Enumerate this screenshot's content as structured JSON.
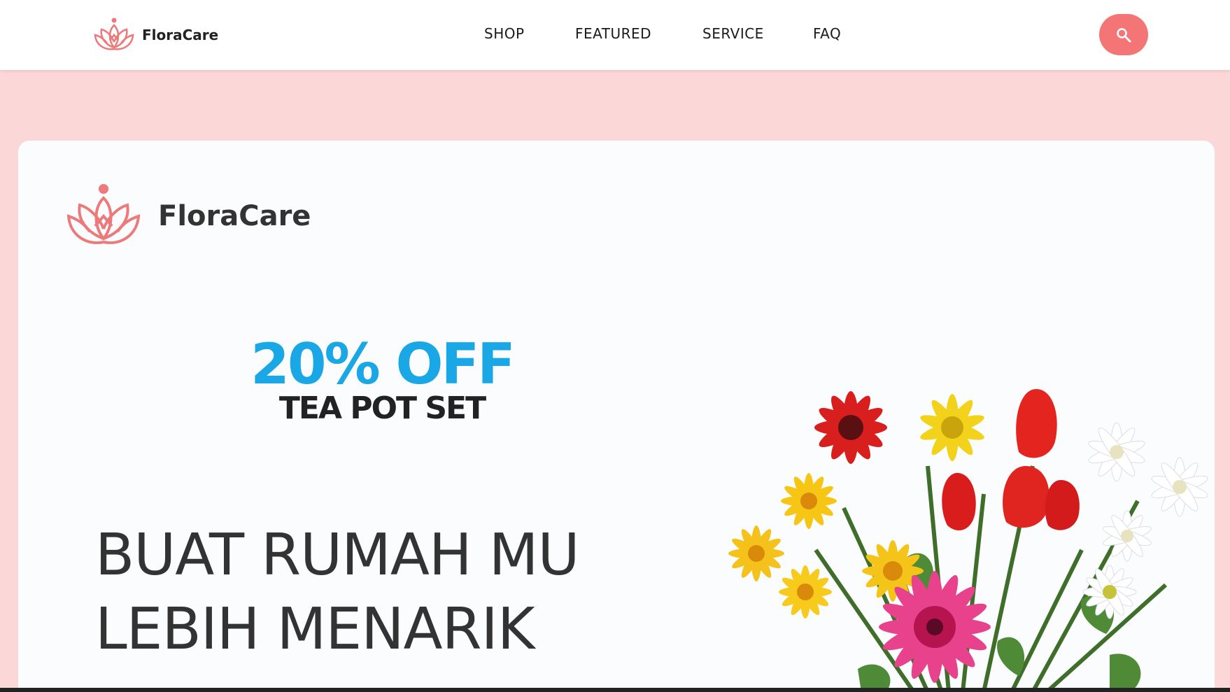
{
  "header": {
    "brand": "FloraCare",
    "nav": [
      {
        "label": "SHOP"
      },
      {
        "label": "FEATURED"
      },
      {
        "label": "SERVICE"
      },
      {
        "label": "FAQ"
      }
    ],
    "search_icon": "search-icon"
  },
  "hero": {
    "brand": "FloraCare",
    "promo_discount": "20% OFF",
    "promo_product": "TEA POT SET",
    "headline_line1": "BUAT RUMAH MU",
    "headline_line2": "LEBIH MENARIK"
  },
  "colors": {
    "page_background": "#fcd7d7",
    "accent": "#f47575",
    "promo_blue": "#19a7e6",
    "logo_pink": "#ec7a7a"
  }
}
